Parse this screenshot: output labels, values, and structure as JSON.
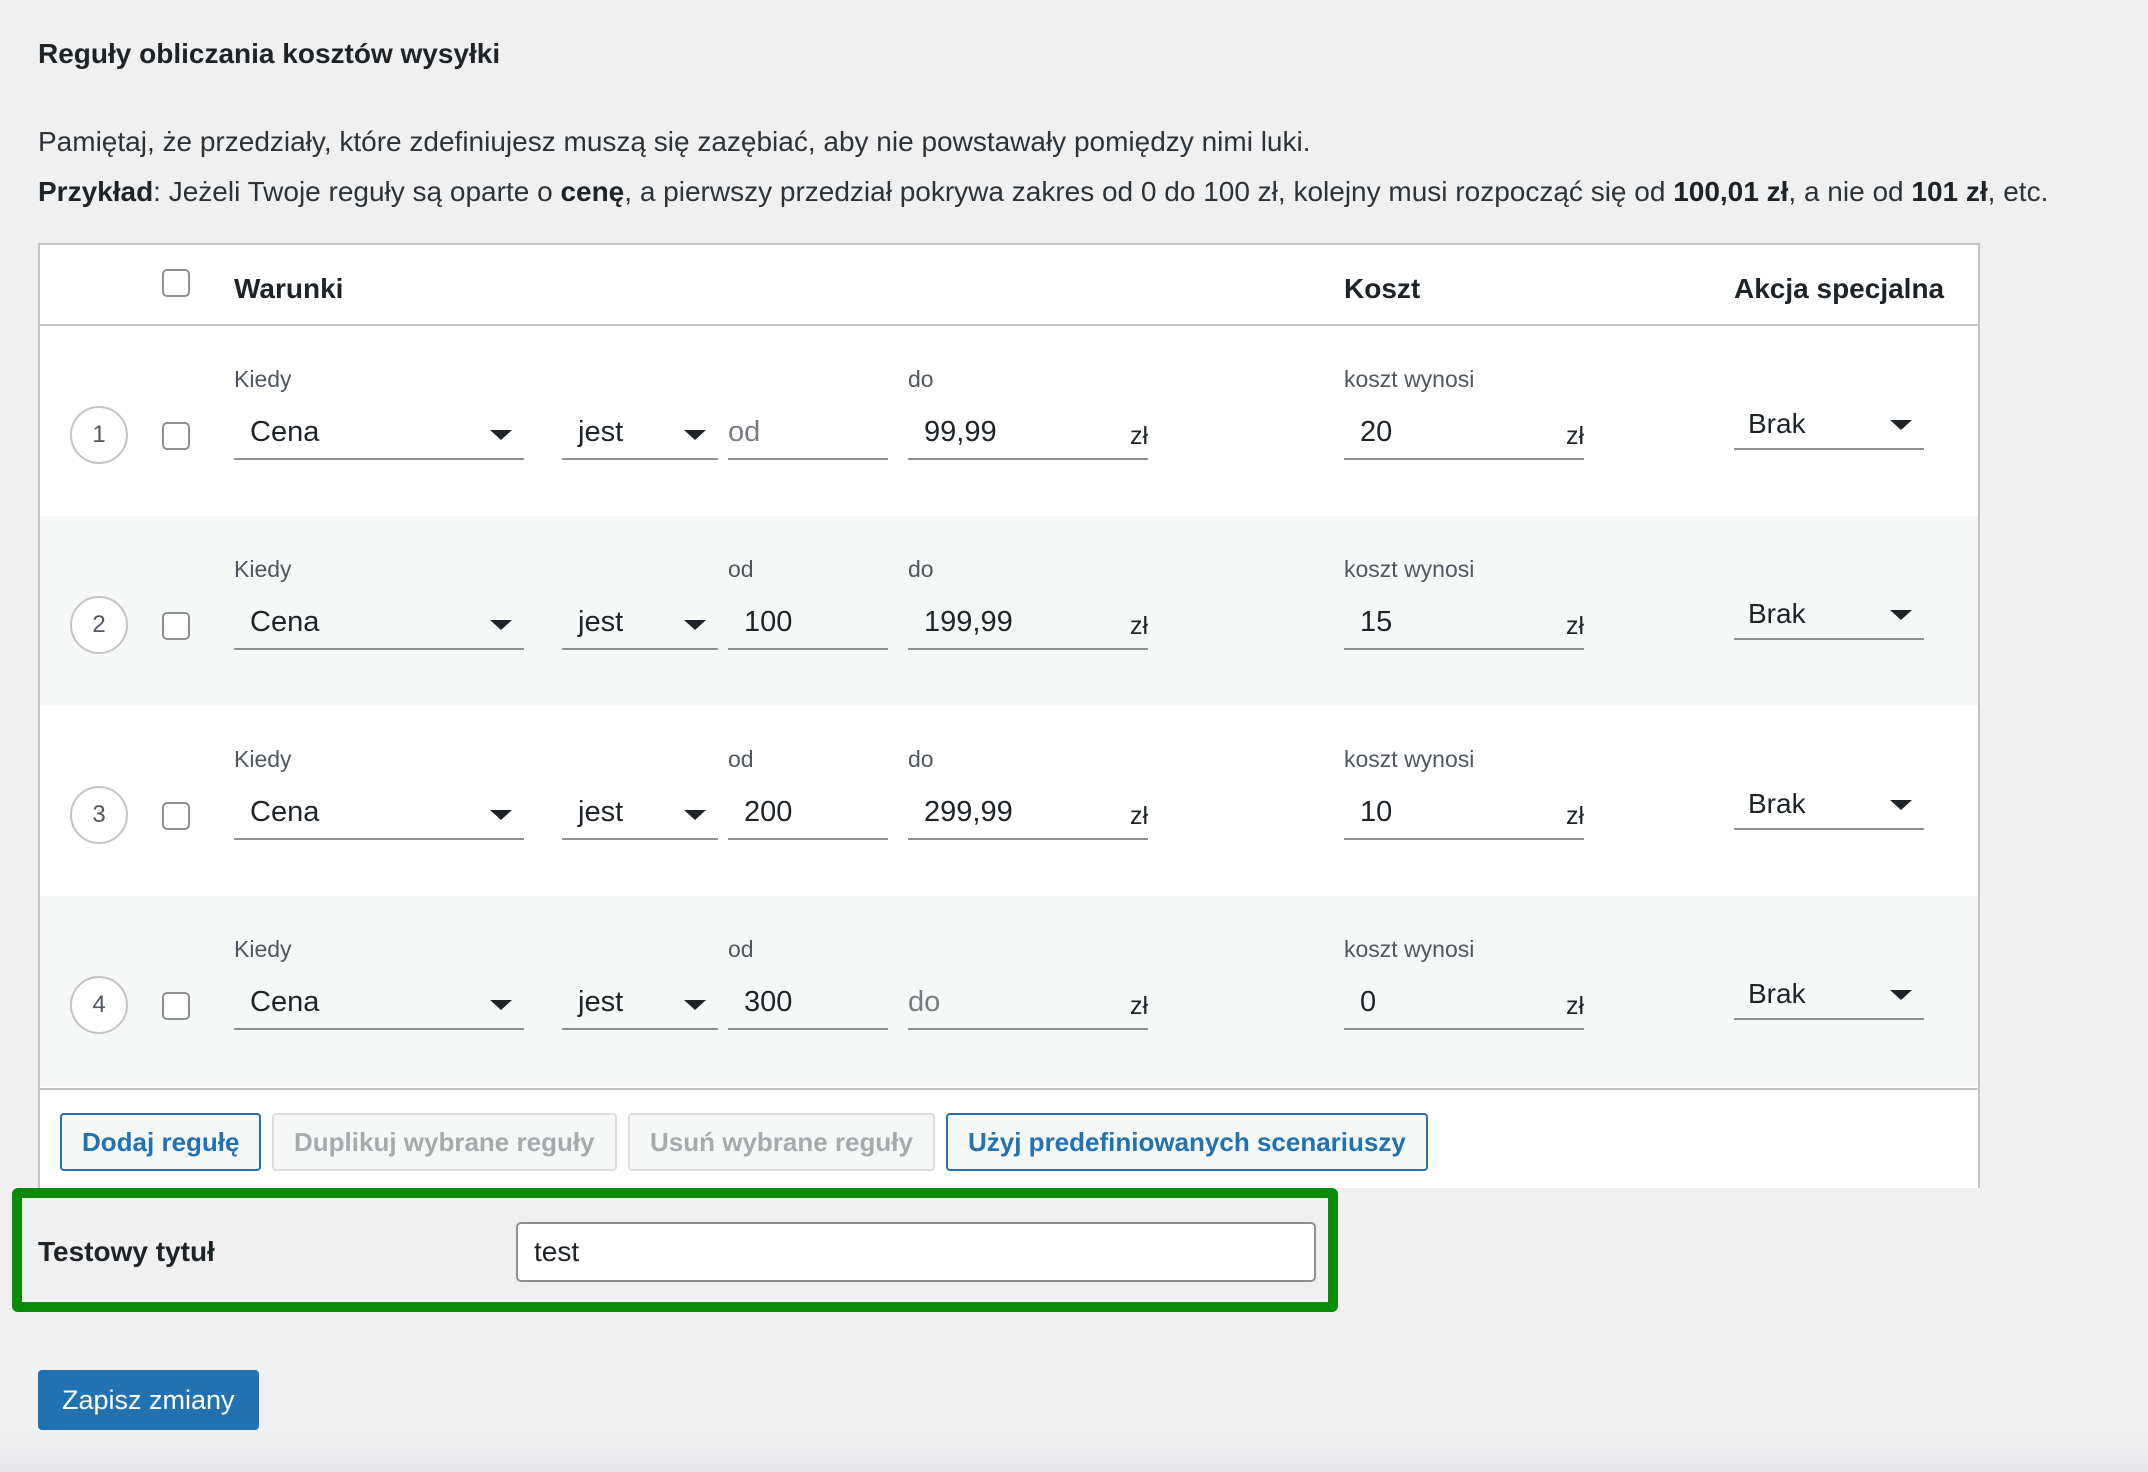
{
  "page_title": "Reguły obliczania kosztów wysyłki",
  "note1": "Pamiętaj, że przedziały, które zdefiniujesz muszą się zazębiać, aby nie powstawały pomiędzy nimi luki.",
  "note2": {
    "label": "Przykład",
    "t1": ": Jeżeli Twoje reguły są oparte o ",
    "b1": "cenę",
    "t2": ", a pierwszy przedział pokrywa zakres od 0 do 100 zł, kolejny musi rozpocząć się od ",
    "b2": "100,01 zł",
    "t3": ", a nie od ",
    "b3": "101 zł",
    "t4": ", etc."
  },
  "table": {
    "headers": {
      "conditions": "Warunki",
      "cost": "Koszt",
      "special_action": "Akcja specjalna"
    },
    "rows": [
      {
        "number": "1",
        "when_label": "Kiedy",
        "when_value": "Cena",
        "operator": "jest",
        "from_label": "",
        "from_value": "",
        "from_placeholder": "od",
        "to_label": "do",
        "to_value": "99,99",
        "to_placeholder": "",
        "unit": "zł",
        "cost_label": "koszt wynosi",
        "cost_value": "20",
        "action": "Brak"
      },
      {
        "number": "2",
        "when_label": "Kiedy",
        "when_value": "Cena",
        "operator": "jest",
        "from_label": "od",
        "from_value": "100",
        "from_placeholder": "",
        "to_label": "do",
        "to_value": "199,99",
        "to_placeholder": "",
        "unit": "zł",
        "cost_label": "koszt wynosi",
        "cost_value": "15",
        "action": "Brak"
      },
      {
        "number": "3",
        "when_label": "Kiedy",
        "when_value": "Cena",
        "operator": "jest",
        "from_label": "od",
        "from_value": "200",
        "from_placeholder": "",
        "to_label": "do",
        "to_value": "299,99",
        "to_placeholder": "",
        "unit": "zł",
        "cost_label": "koszt wynosi",
        "cost_value": "10",
        "action": "Brak"
      },
      {
        "number": "4",
        "when_label": "Kiedy",
        "when_value": "Cena",
        "operator": "jest",
        "from_label": "od",
        "from_value": "300",
        "from_placeholder": "",
        "to_label": "",
        "to_value": "",
        "to_placeholder": "do",
        "unit": "zł",
        "cost_label": "koszt wynosi",
        "cost_value": "0",
        "action": "Brak"
      }
    ],
    "buttons": {
      "add": "Dodaj regułę",
      "duplicate": "Duplikuj wybrane reguły",
      "delete": "Usuń wybrane reguły",
      "predefined": "Użyj predefiniowanych scenariuszy"
    }
  },
  "test_title": {
    "label": "Testowy tytuł",
    "value": "test"
  },
  "save_button": "Zapisz zmiany",
  "colors": {
    "accent": "#2271b1",
    "highlight": "#0a8b0a"
  }
}
